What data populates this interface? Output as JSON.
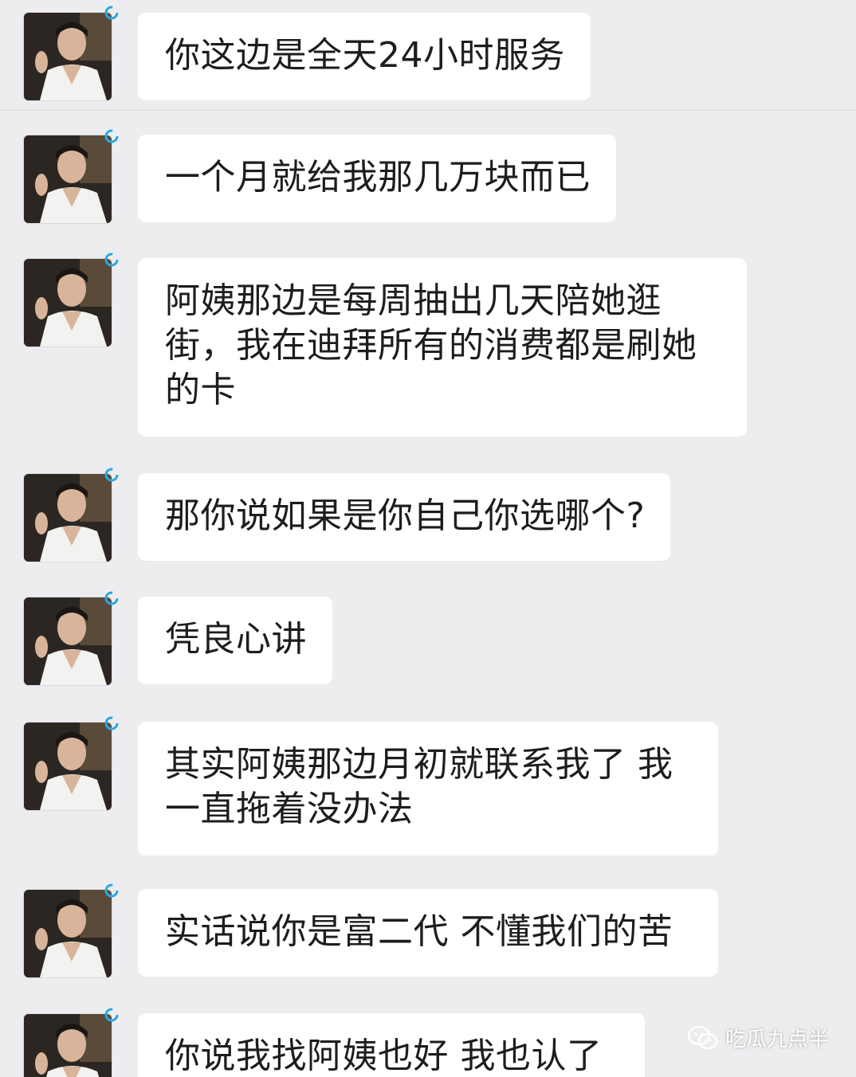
{
  "chat": {
    "messages": [
      {
        "text": "你这边是全天24小时服务"
      },
      {
        "text": "一个月就给我那几万块而已"
      },
      {
        "text": "阿姨那边是每周抽出几天陪她逛\n街，我在迪拜所有的消费都是刷她\n的卡"
      },
      {
        "text": "那你说如果是你自己你选哪个?"
      },
      {
        "text": "凭良心讲"
      },
      {
        "text": "其实阿姨那边月初就联系我了 我\n一直拖着没办法"
      },
      {
        "text": "实话说你是富二代 不懂我们的苦"
      },
      {
        "text": "你说我找阿姨也好 我也认了"
      }
    ]
  },
  "watermark": {
    "icon": "wechat-icon",
    "text": "吃瓜九点半"
  },
  "colors": {
    "background": "#ededf0",
    "bubble": "#ffffff",
    "text": "#1d1d1f",
    "status_ring": "#2aa8e0"
  }
}
